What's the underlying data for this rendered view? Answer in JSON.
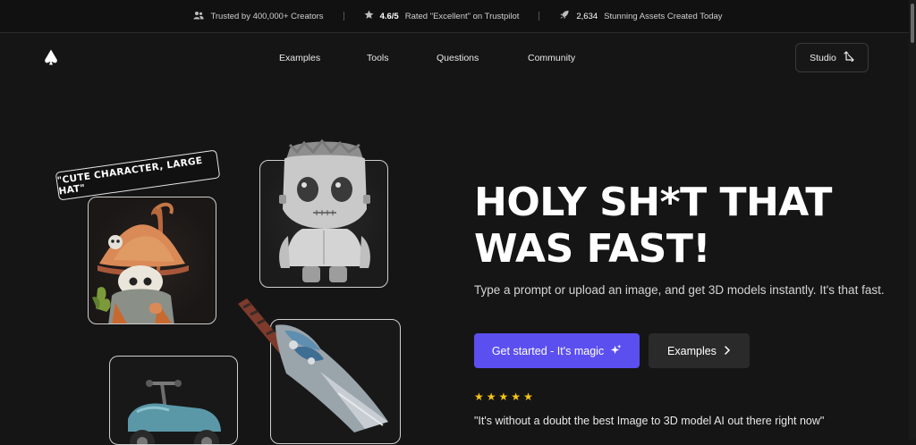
{
  "topbar": {
    "items": [
      {
        "icon": "users-icon",
        "text": "Trusted by 400,000+ Creators"
      },
      {
        "icon": "star-icon",
        "strong": "4.6/5",
        "text": "Rated \"Excellent\" on Trustpilot"
      },
      {
        "icon": "rocket-icon",
        "strong": "2,634",
        "text": "Stunning Assets Created Today"
      }
    ]
  },
  "nav": {
    "logo_icon": "spade-logo-icon",
    "links": [
      "Examples",
      "Tools",
      "Questions",
      "Community"
    ],
    "studio_label": "Studio"
  },
  "hero": {
    "prompt_tag": "\"CUTE CHARACTER, LARGE HAT\"",
    "headline_line1": "HOLY SH*T THAT",
    "headline_line2": "WAS FAST!",
    "subtext": "Type a prompt or upload an image, and get 3D models instantly. It's that fast.",
    "primary_button": "Get started - It's magic",
    "secondary_button": "Examples",
    "rating_stars": 5,
    "testimonial": "\"It's without a doubt the best Image to 3D model AI out there right now\""
  },
  "colors": {
    "background": "#151515",
    "accent": "#5b4ff0",
    "star": "#f5c518"
  }
}
